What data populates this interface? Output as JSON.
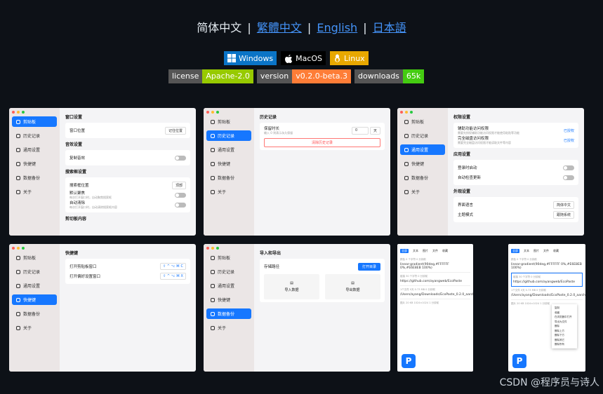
{
  "lang": {
    "current": "简体中文",
    "links": [
      "繁體中文",
      "English",
      "日本語"
    ],
    "sep": "|"
  },
  "os": {
    "windows": "Windows",
    "macos": "MacOS",
    "linux": "Linux"
  },
  "badges": [
    {
      "k": "license",
      "v": "Apache-2.0",
      "color": "#97ca00"
    },
    {
      "k": "version",
      "v": "v0.2.0-beta.3",
      "color": "#fe7d37"
    },
    {
      "k": "downloads",
      "v": "65k",
      "color": "#4c1"
    }
  ],
  "nav": [
    "剪贴板",
    "历史记录",
    "通用设置",
    "快捷键",
    "数据备份",
    "关于"
  ],
  "s1": {
    "win_title": "窗口设置",
    "win_pos": "窗口位置",
    "win_pos_val": "记住位置",
    "audio_title": "音效设置",
    "copy_sound": "复制音效",
    "search_title": "搜索框设置",
    "search_pos": "搜索框位置",
    "search_pos_val": "顶部",
    "default_focus": "默认聚焦",
    "default_focus_sub": "每次打开窗口时，自动聚焦搜索框",
    "auto_clear": "自动清除",
    "auto_clear_sub": "每次打开窗口时，自动清除搜索框内容",
    "content_title": "剪切板内容"
  },
  "s2": {
    "title": "历史记录",
    "keep": "保留时长",
    "keep_sub": "输入 0 则表示永久保留",
    "keep_val": "0",
    "unit": "天",
    "clear": "清除历史记录"
  },
  "s3": {
    "perm_title": "权限设置",
    "a11y": "辅助功能访问权限",
    "a11y_sub": "需要先授权辅助功能访问权限才能使用粘贴等功能",
    "disk": "完全磁盘访问权限",
    "disk_sub": "需要完全磁盘访问权限才能读取文件等内容",
    "authed": "已授权",
    "app_title": "应用设置",
    "login": "登录时启动",
    "update": "自动检查更新",
    "look_title": "外观设置",
    "lang": "界面语言",
    "lang_val": "简体中文",
    "theme": "主题模式",
    "theme_val": "跟随系统"
  },
  "s4": {
    "title": "快捷键",
    "open_clip": "打开剪贴板窗口",
    "open_pref": "打开偏好设置窗口",
    "key1": "⇧ ^ ⌥ ⌘ C",
    "key2": "⇧ ^ ⌥ ⌘ X"
  },
  "s5": {
    "title": "导入和导出",
    "path": "存储路径",
    "open_dir": "打开目录",
    "import": "导入数据",
    "export": "导出数据"
  },
  "phone": {
    "tabs": [
      "全部",
      "文本",
      "图片",
      "文件",
      "收藏"
    ],
    "meta1": "颜色  0 个字符  0 分钟前",
    "item1": "linear-gradient(90deg,#FFFFFF 0%,#E6E8EB 100%)",
    "meta2": "链接  30 个字符  0 分钟前",
    "item2": "https://github.com/ayangweb/EcoPaste",
    "meta3": "1个文件  0天  0.73 MB  0 分钟前",
    "item3": "/Users/ayang/Downloads/EcoPaste_0.2.0_aarch64.dmg",
    "meta4": "图片  20 KB  1024×1024  1 分钟前",
    "menu": [
      "复制",
      "收藏",
      "在浏览器中打开",
      "导出为文件",
      "删除",
      "删除上方",
      "删除下方",
      "删除其它",
      "删除所有"
    ]
  },
  "watermark": "CSDN @程序员与诗人"
}
